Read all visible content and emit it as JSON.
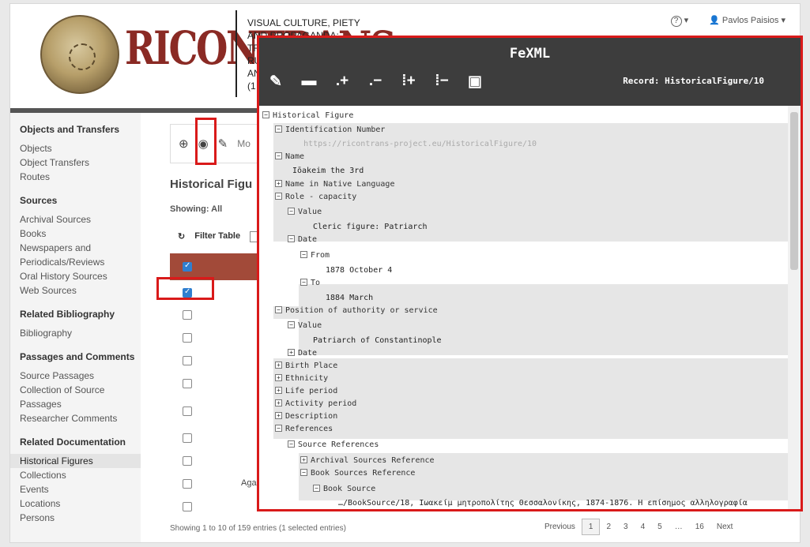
{
  "header": {
    "title_lines": [
      "VISUAL CULTURE, PIETY",
      "AND PROPAGANDA:",
      "TR",
      "RU",
      "AN",
      "(1"
    ],
    "help_label": "?",
    "user_name": "Pavlos Paisios"
  },
  "sidebar": {
    "sections": [
      {
        "heading": "Objects and Transfers",
        "items": [
          "Objects",
          "Object Transfers",
          "Routes"
        ]
      },
      {
        "heading": "Sources",
        "items": [
          "Archival Sources",
          "Books",
          "Newspapers and",
          "Periodicals/Reviews",
          "Oral History Sources",
          "Web Sources"
        ]
      },
      {
        "heading": "Related Bibliography",
        "items": [
          "Bibliography"
        ]
      },
      {
        "heading": "Passages and Comments",
        "items": [
          "Source Passages",
          "Collection of Source",
          "Passages",
          "Researcher Comments"
        ]
      },
      {
        "heading": "Related Documentation",
        "items": [
          "Historical Figures",
          "Collections",
          "Events",
          "Locations",
          "Persons"
        ]
      }
    ]
  },
  "main": {
    "toolbar_mo": "Mo",
    "heading": "Historical Figu",
    "showing": "Showing: All",
    "filter_label": "Filter Table",
    "aga": "Aga",
    "footer_info": "Showing 1 to 10 of 159 entries (1 selected entries)",
    "pager": [
      "Previous",
      "1",
      "2",
      "3",
      "4",
      "5",
      "…",
      "16",
      "Next"
    ]
  },
  "fexml": {
    "title": "FeXML",
    "record": "Record: HistoricalFigure/10",
    "tools": [
      "edit-icon",
      "folder-icon",
      "add-icon",
      "remove-icon",
      "add-after-icon",
      "remove-all-icon",
      "save-icon"
    ],
    "nodes": [
      {
        "label": "Historical Figure",
        "toggle": "⊟"
      },
      {
        "label": "Identification Number",
        "toggle": "⊟"
      },
      {
        "label": "https://ricontrans-project.eu/HistoricalFigure/10",
        "toggle": ""
      },
      {
        "label": "Name",
        "toggle": "⊟"
      },
      {
        "label": "Iōakeim the 3rd",
        "toggle": ""
      },
      {
        "label": "Name in Native Language",
        "toggle": "⊞"
      },
      {
        "label": "Role - capacity",
        "toggle": "⊟"
      },
      {
        "label": "Value",
        "toggle": "⊟"
      },
      {
        "label": "Cleric figure: Patriarch",
        "toggle": ""
      },
      {
        "label": "Date",
        "toggle": "⊟"
      },
      {
        "label": "From",
        "toggle": "⊟"
      },
      {
        "label": "1878 October 4",
        "toggle": ""
      },
      {
        "label": "To",
        "toggle": "⊟"
      },
      {
        "label": "1884 March",
        "toggle": ""
      },
      {
        "label": "Position of authority or service",
        "toggle": "⊟"
      },
      {
        "label": "Value",
        "toggle": "⊟"
      },
      {
        "label": "Patriarch of Constantinople",
        "toggle": ""
      },
      {
        "label": "Date",
        "toggle": "⊞"
      },
      {
        "label": "Birth Place",
        "toggle": "⊞"
      },
      {
        "label": "Ethnicity",
        "toggle": "⊞"
      },
      {
        "label": "Life period",
        "toggle": "⊞"
      },
      {
        "label": "Activity period",
        "toggle": "⊞"
      },
      {
        "label": "Description",
        "toggle": "⊞"
      },
      {
        "label": "References",
        "toggle": "⊟"
      },
      {
        "label": "Source References",
        "toggle": "⊟"
      },
      {
        "label": "Archival Sources Reference",
        "toggle": "⊞"
      },
      {
        "label": "Book Sources Reference",
        "toggle": "⊟"
      },
      {
        "label": "Book Source",
        "toggle": "⊟"
      },
      {
        "label": "…/BookSource/18, Ιωακείμ μητροπολίτης Θεσσαλονίκης, 1874-1876. Η επίσημος αλληλογραφία",
        "toggle": ""
      }
    ]
  },
  "colors": {
    "highlight": "#d91a1a",
    "table_head": "#a24a39",
    "fe_header": "#3d3d3d"
  }
}
